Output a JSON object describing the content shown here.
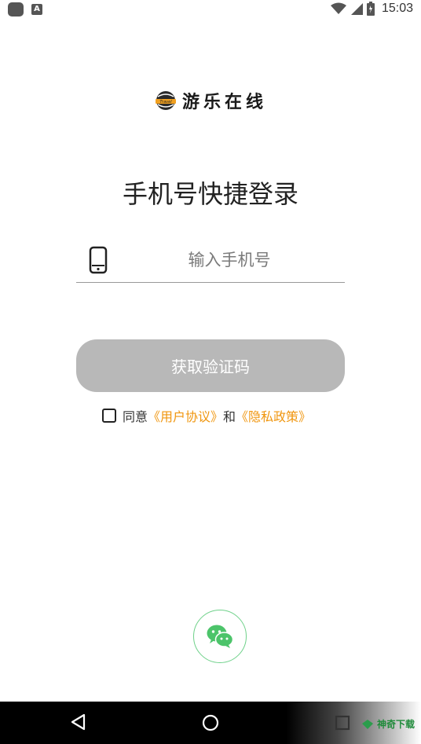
{
  "status_bar": {
    "time": "15:03",
    "icons": [
      "notification-dot-icon",
      "android-a-icon",
      "wifi-icon",
      "signal-icon",
      "battery-icon"
    ]
  },
  "brand": {
    "name": "游乐在线",
    "logo_icon": "travel-globe-logo",
    "logo_mark_text": "Travel"
  },
  "login": {
    "title": "手机号快捷登录",
    "phone_icon": "phone-icon",
    "phone_value": "",
    "phone_placeholder": "输入手机号",
    "get_code_label": "获取验证码",
    "agree_prefix": "同意",
    "user_agreement": "《用户协议》",
    "and": "和",
    "privacy_policy": "《隐私政策》",
    "agree_checked": false
  },
  "third_party": {
    "wechat_icon": "wechat-icon"
  },
  "nav_bar": {
    "icons": [
      "back-triangle-icon",
      "home-circle-icon",
      "recents-square-icon"
    ]
  },
  "watermark": {
    "text": "神奇下载"
  },
  "colors": {
    "accent_link": "#f0960f",
    "button_disabled": "#b8b8b8",
    "wechat_green": "#4cc46a"
  }
}
